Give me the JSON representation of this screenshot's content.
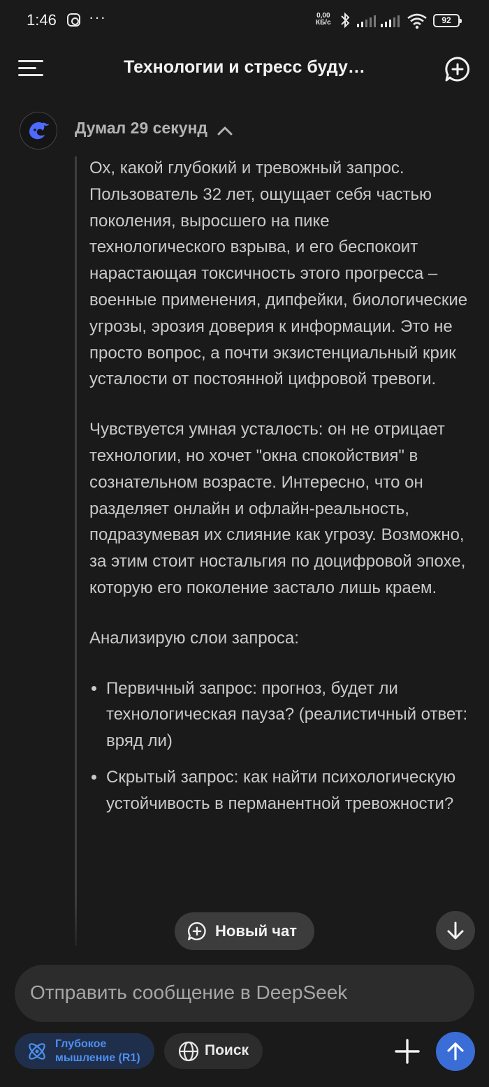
{
  "status_bar": {
    "time": "1:46",
    "net_speed_value": "0,00",
    "net_speed_unit": "КБ/с",
    "battery": "92",
    "icons": [
      "instagram-icon",
      "more-dots-icon",
      "bluetooth-icon",
      "signal-icon",
      "signal-icon",
      "wifi-icon",
      "battery-icon"
    ]
  },
  "header": {
    "title": "Технологии и стресс буду…",
    "menu_icon": "hamburger-icon",
    "new_chat_icon": "new-chat-icon"
  },
  "thinking": {
    "label": "Думал 29 секунд",
    "expanded": true,
    "avatar_icon": "deepseek-whale-icon"
  },
  "reasoning": {
    "paragraphs": [
      "Ох, какой глубокий и тревожный запрос. Пользователь 32 лет, ощущает себя частью поколения, выросшего на пике технологического взрыва, и его беспокоит нарастающая токсичность этого прогресса – военные применения, дипфейки, биологические угрозы, эрозия доверия к информации. Это не просто вопрос, а почти экзистенциальный крик усталости от постоянной цифровой тревоги.",
      "Чувствуется умная усталость: он не отрицает технологии, но хочет \"окна спокойствия\" в сознательном возрасте. Интересно, что он разделяет онлайн и офлайн-реальность, подразумевая их слияние как угрозу. Возможно, за этим стоит ностальгия по доцифровой эпохе, которую его поколение застало лишь краем.",
      "Анализирую слои запроса:"
    ],
    "bullets": [
      "Первичный запрос: прогноз, будет ли технологическая пауза? (реалистичный ответ: вряд ли)",
      "Скрытый запрос: как найти психологическую устойчивость в перманентной тревожности?"
    ]
  },
  "floating": {
    "new_chat_label": "Новый чат",
    "scroll_down_icon": "arrow-down-icon"
  },
  "composer": {
    "placeholder": "Отправить сообщение в DeepSeek",
    "deep_think_label_line1": "Глубокое",
    "deep_think_label_line2": "мышление (R1)",
    "search_label": "Поиск",
    "accent_color": "#4d8ff0",
    "send_color": "#3a6ed6"
  }
}
